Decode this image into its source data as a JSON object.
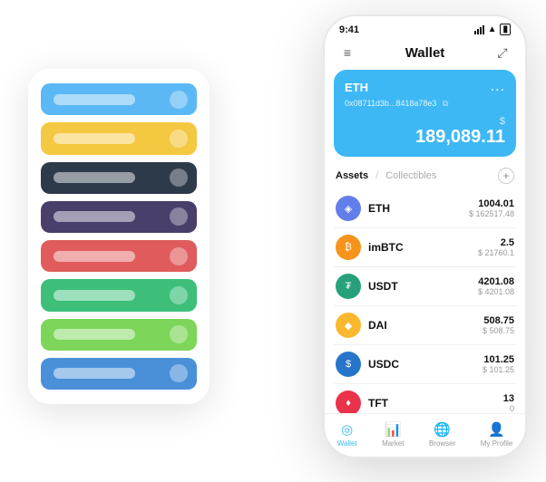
{
  "scene": {
    "bg_card": {
      "rows": [
        {
          "color": "#5bb8f5",
          "id": "row-blue1"
        },
        {
          "color": "#f5c842",
          "id": "row-yellow"
        },
        {
          "color": "#2d3a4a",
          "id": "row-dark"
        },
        {
          "color": "#4a3f6b",
          "id": "row-purple"
        },
        {
          "color": "#e05c5c",
          "id": "row-red"
        },
        {
          "color": "#3dbf7a",
          "id": "row-green"
        },
        {
          "color": "#7dd65a",
          "id": "row-lightgreen"
        },
        {
          "color": "#4a90d9",
          "id": "row-blue2"
        }
      ]
    },
    "phone": {
      "status_bar": {
        "time": "9:41",
        "signal": "●●●",
        "wifi": "wifi",
        "battery": "battery"
      },
      "header": {
        "menu_icon": "≡",
        "title": "Wallet",
        "expand_icon": "⤢"
      },
      "eth_card": {
        "title": "ETH",
        "address": "0x08711d3b...8418a78e3",
        "copy_icon": "⧉",
        "dots": "...",
        "currency": "$",
        "amount": "189,089.11"
      },
      "assets_section": {
        "tab_active": "Assets",
        "separator": "/",
        "tab_inactive": "Collectibles",
        "add_icon": "+"
      },
      "assets": [
        {
          "icon_color": "#627eea",
          "icon_symbol": "◈",
          "name": "ETH",
          "amount": "1004.01",
          "usd": "$ 162517.48"
        },
        {
          "icon_color": "#f7931a",
          "icon_symbol": "₿",
          "name": "imBTC",
          "amount": "2.5",
          "usd": "$ 21760.1"
        },
        {
          "icon_color": "#26a17b",
          "icon_symbol": "₮",
          "name": "USDT",
          "amount": "4201.08",
          "usd": "$ 4201.08"
        },
        {
          "icon_color": "#fab82e",
          "icon_symbol": "◆",
          "name": "DAI",
          "amount": "508.75",
          "usd": "$ 508.75"
        },
        {
          "icon_color": "#2775ca",
          "icon_symbol": "$",
          "name": "USDC",
          "amount": "101.25",
          "usd": "$ 101.25"
        },
        {
          "icon_color": "#ff4444",
          "icon_symbol": "♦",
          "name": "TFT",
          "amount": "13",
          "usd": "0"
        }
      ],
      "bottom_nav": [
        {
          "icon": "◎",
          "label": "Wallet",
          "active": true
        },
        {
          "icon": "📊",
          "label": "Market",
          "active": false
        },
        {
          "icon": "🌐",
          "label": "Browser",
          "active": false
        },
        {
          "icon": "👤",
          "label": "My Profile",
          "active": false
        }
      ]
    }
  }
}
